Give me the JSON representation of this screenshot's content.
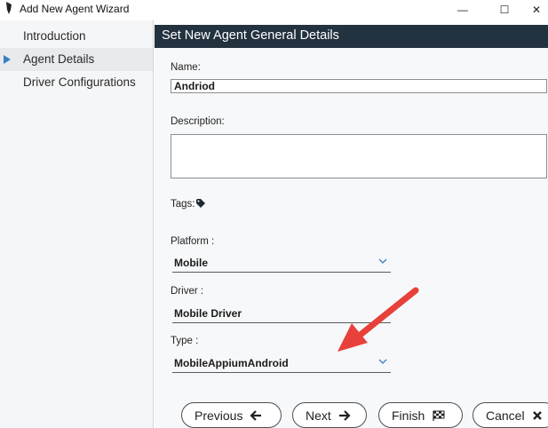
{
  "window": {
    "title": "Add New Agent Wizard",
    "min_glyph": "—",
    "max_glyph": "☐",
    "close_glyph": "✕"
  },
  "sidebar": {
    "items": [
      {
        "label": "Introduction"
      },
      {
        "label": "Agent Details",
        "active": true
      },
      {
        "label": "Driver Configurations"
      }
    ]
  },
  "main": {
    "header": "Set New Agent General Details",
    "name": {
      "label": "Name:",
      "value": "Andriod"
    },
    "description": {
      "label": "Description:",
      "value": ""
    },
    "tags": {
      "label": "Tags:"
    },
    "platform": {
      "label": "Platform :",
      "value": "Mobile"
    },
    "driver": {
      "label": "Driver :",
      "value": "Mobile Driver"
    },
    "type": {
      "label": "Type :",
      "value": "MobileAppiumAndroid"
    }
  },
  "buttons": {
    "previous": "Previous",
    "next": "Next",
    "finish": "Finish",
    "cancel": "Cancel"
  },
  "colors": {
    "header_bg": "#23323f",
    "accent_arrow": "#e8403a",
    "nav_arrow": "#3a7fc6"
  }
}
